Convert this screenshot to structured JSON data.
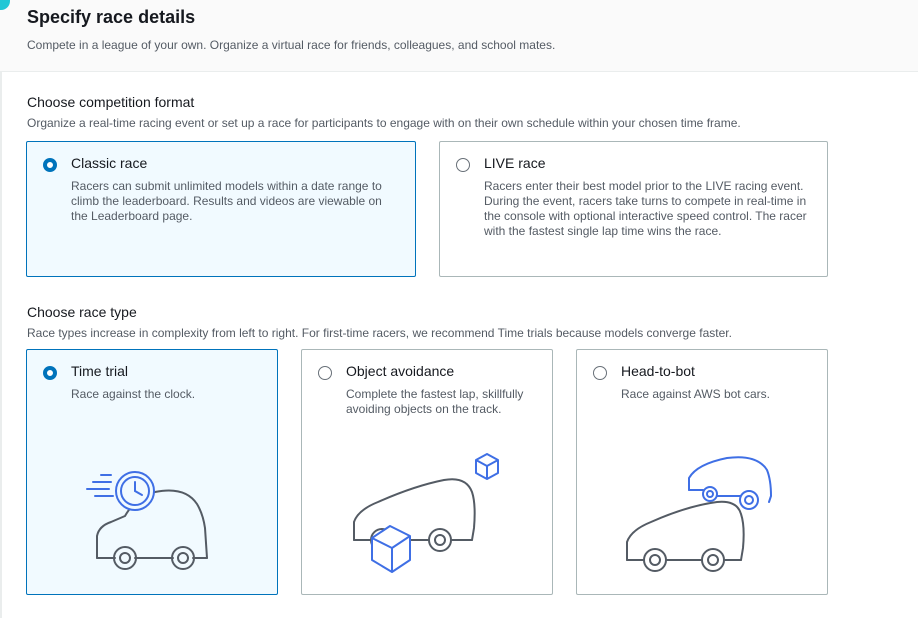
{
  "header": {
    "title": "Specify race details",
    "description": "Compete in a league of your own. Organize a virtual race for friends, colleagues, and school mates."
  },
  "format": {
    "title": "Choose competition format",
    "description": "Organize a real-time racing event or set up a race for participants to engage with on their own schedule within your chosen time frame.",
    "options": [
      {
        "label": "Classic race",
        "description": "Racers can submit unlimited models within a date range to climb the leaderboard. Results and videos are viewable on the Leaderboard page.",
        "selected": true
      },
      {
        "label": "LIVE race",
        "description": "Racers enter their best model prior to the LIVE racing event. During the event, racers take turns to compete in real-time in the console with optional interactive speed control. The racer with the fastest single lap time wins the race.",
        "selected": false
      }
    ]
  },
  "race_type": {
    "title": "Choose race type",
    "description": "Race types increase in complexity from left to right. For first-time racers, we recommend Time trials because models converge faster.",
    "options": [
      {
        "label": "Time trial",
        "description": "Race against the clock.",
        "selected": true,
        "illustration": "clock-car-icon"
      },
      {
        "label": "Object avoidance",
        "description": "Complete the fastest lap, skillfully avoiding objects on the track.",
        "selected": false,
        "illustration": "obstacle-car-icon"
      },
      {
        "label": "Head-to-bot",
        "description": "Race against AWS bot cars.",
        "selected": false,
        "illustration": "two-cars-icon"
      }
    ]
  },
  "colors": {
    "accent": "#0073bb",
    "selected_bg": "#f1faff",
    "illustration_line": "#545b64",
    "illustration_accent": "#3f6fe5"
  }
}
